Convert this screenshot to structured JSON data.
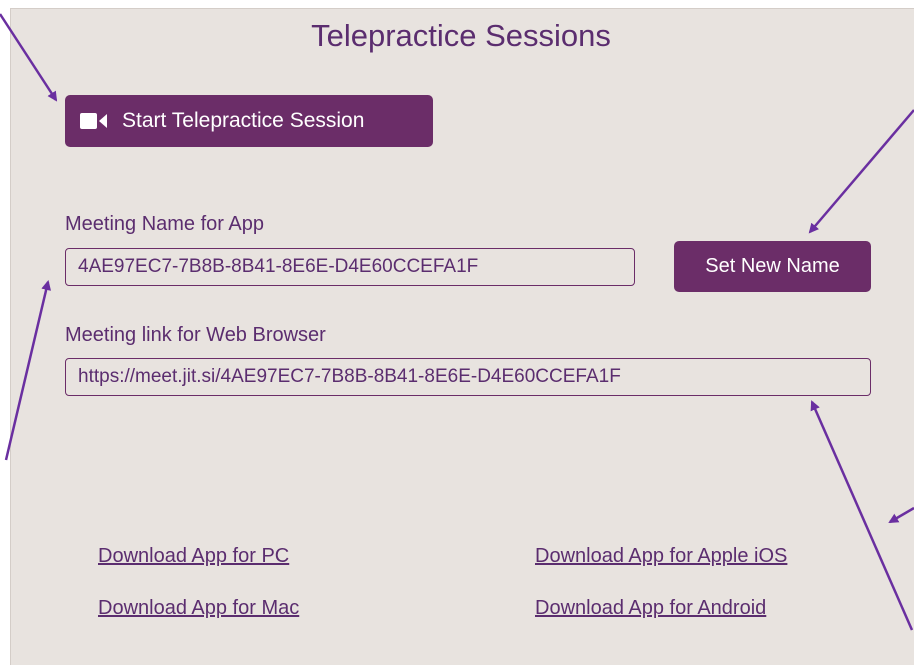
{
  "page": {
    "title": "Telepractice Sessions"
  },
  "start_button": {
    "label": "Start Telepractice Session",
    "icon": "video-camera-icon"
  },
  "meeting_app": {
    "label": "Meeting Name for App",
    "value": "4AE97EC7-7B8B-8B41-8E6E-D4E60CCEFA1F",
    "set_name_label": "Set New Name"
  },
  "meeting_web": {
    "label": "Meeting link for Web Browser",
    "value": "https://meet.jit.si/4AE97EC7-7B8B-8B41-8E6E-D4E60CCEFA1F"
  },
  "downloads": {
    "pc": "Download App for PC",
    "mac": "Download App for Mac",
    "ios": "Download App for Apple iOS",
    "android": "Download App for Android"
  },
  "colors": {
    "accent": "#6b2d68",
    "text": "#5b2d6f",
    "background": "#e8e3df",
    "annotation_arrow": "#6a2fa0"
  }
}
